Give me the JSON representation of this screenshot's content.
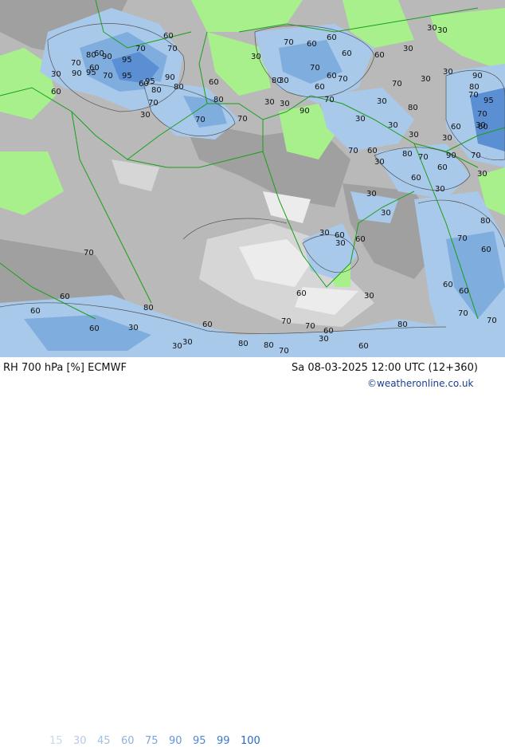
{
  "map": {
    "colors": {
      "land": "#a8f08c",
      "gray_low": "#b9b9b9",
      "gray_mid": "#a0a0a0",
      "gray_light": "#d6d6d6",
      "white": "#ececec",
      "blue_60": "#a9c9ea",
      "blue_75": "#7fadde",
      "blue_90": "#5b8fd4",
      "border": "#18a018",
      "contour": "#555555"
    },
    "labels": [
      "60",
      "70",
      "70",
      "60",
      "80",
      "90",
      "95",
      "70",
      "60",
      "30",
      "70",
      "60",
      "90",
      "95",
      "95",
      "80",
      "80",
      "70",
      "95",
      "90",
      "60",
      "30",
      "80",
      "60",
      "70",
      "80",
      "30",
      "70",
      "60",
      "70",
      "30",
      "30",
      "30",
      "60",
      "70",
      "60",
      "70",
      "60",
      "90",
      "30",
      "30",
      "30",
      "30",
      "30",
      "30",
      "30",
      "30",
      "30",
      "60",
      "60",
      "70",
      "30",
      "70",
      "80",
      "30",
      "70",
      "60",
      "80",
      "70",
      "60",
      "60",
      "30",
      "30",
      "90",
      "70",
      "80",
      "95",
      "70",
      "30",
      "60",
      "70",
      "90",
      "60",
      "30",
      "30",
      "30",
      "60",
      "60",
      "30",
      "70",
      "60",
      "80",
      "60",
      "60",
      "70",
      "70",
      "30",
      "60",
      "70",
      "60",
      "30",
      "70",
      "60",
      "80",
      "80",
      "80",
      "70",
      "60",
      "30",
      "30",
      "30",
      "80",
      "60",
      "60",
      "60",
      "70"
    ]
  },
  "footer": {
    "title": "RH 700 hPa [%] ECMWF",
    "datetime": "Sa 08-03-2025 12:00 UTC (12+360)",
    "credit": "©weatheronline.co.uk",
    "legend": [
      {
        "value": "15",
        "color": "#c8d8ee"
      },
      {
        "value": "30",
        "color": "#b4cce8"
      },
      {
        "value": "45",
        "color": "#a0c0e4"
      },
      {
        "value": "60",
        "color": "#8cb4e0"
      },
      {
        "value": "75",
        "color": "#78a6dc"
      },
      {
        "value": "90",
        "color": "#6496d6"
      },
      {
        "value": "95",
        "color": "#5088d0"
      },
      {
        "value": "99",
        "color": "#3c78ca"
      },
      {
        "value": "100",
        "color": "#2868c4"
      }
    ]
  }
}
